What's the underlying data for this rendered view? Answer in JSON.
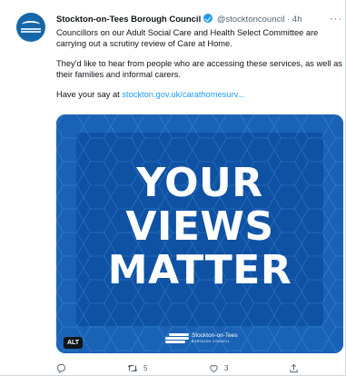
{
  "tweet": {
    "author_name": "Stockton-on-Tees Borough Council",
    "handle": "@stocktoncouncil",
    "time": "4h",
    "paragraph1": "Councillors on our Adult Social Care and Health Select Committee are carrying out a scrutiny review of Care at Home.",
    "paragraph2": "They'd like to hear from people who are accessing these services, as well as their families and informal carers.",
    "paragraph3_prefix": "Have your say at ",
    "paragraph3_link": "stockton.gov.uk/carathomesurv...",
    "more_label": "···"
  },
  "media": {
    "line1": "YOUR",
    "line2": "VIEWS",
    "line3": "MATTER",
    "alt_badge": "ALT",
    "logo_text": "Stockton-on-Tees",
    "logo_subtext": "BOROUGH COUNCIL"
  },
  "actions": {
    "reply_count": "",
    "retweet_count": "5",
    "like_count": "3"
  },
  "icons": {
    "avatar": "council-logo-avatar",
    "verified": "verified-badge-icon",
    "reply": "reply-icon",
    "retweet": "retweet-icon",
    "like": "heart-icon",
    "share": "share-icon"
  },
  "colors": {
    "accent": "#1d9bf0",
    "media_blue": "#1a62b5",
    "text": "#0f1419",
    "muted": "#536471"
  }
}
